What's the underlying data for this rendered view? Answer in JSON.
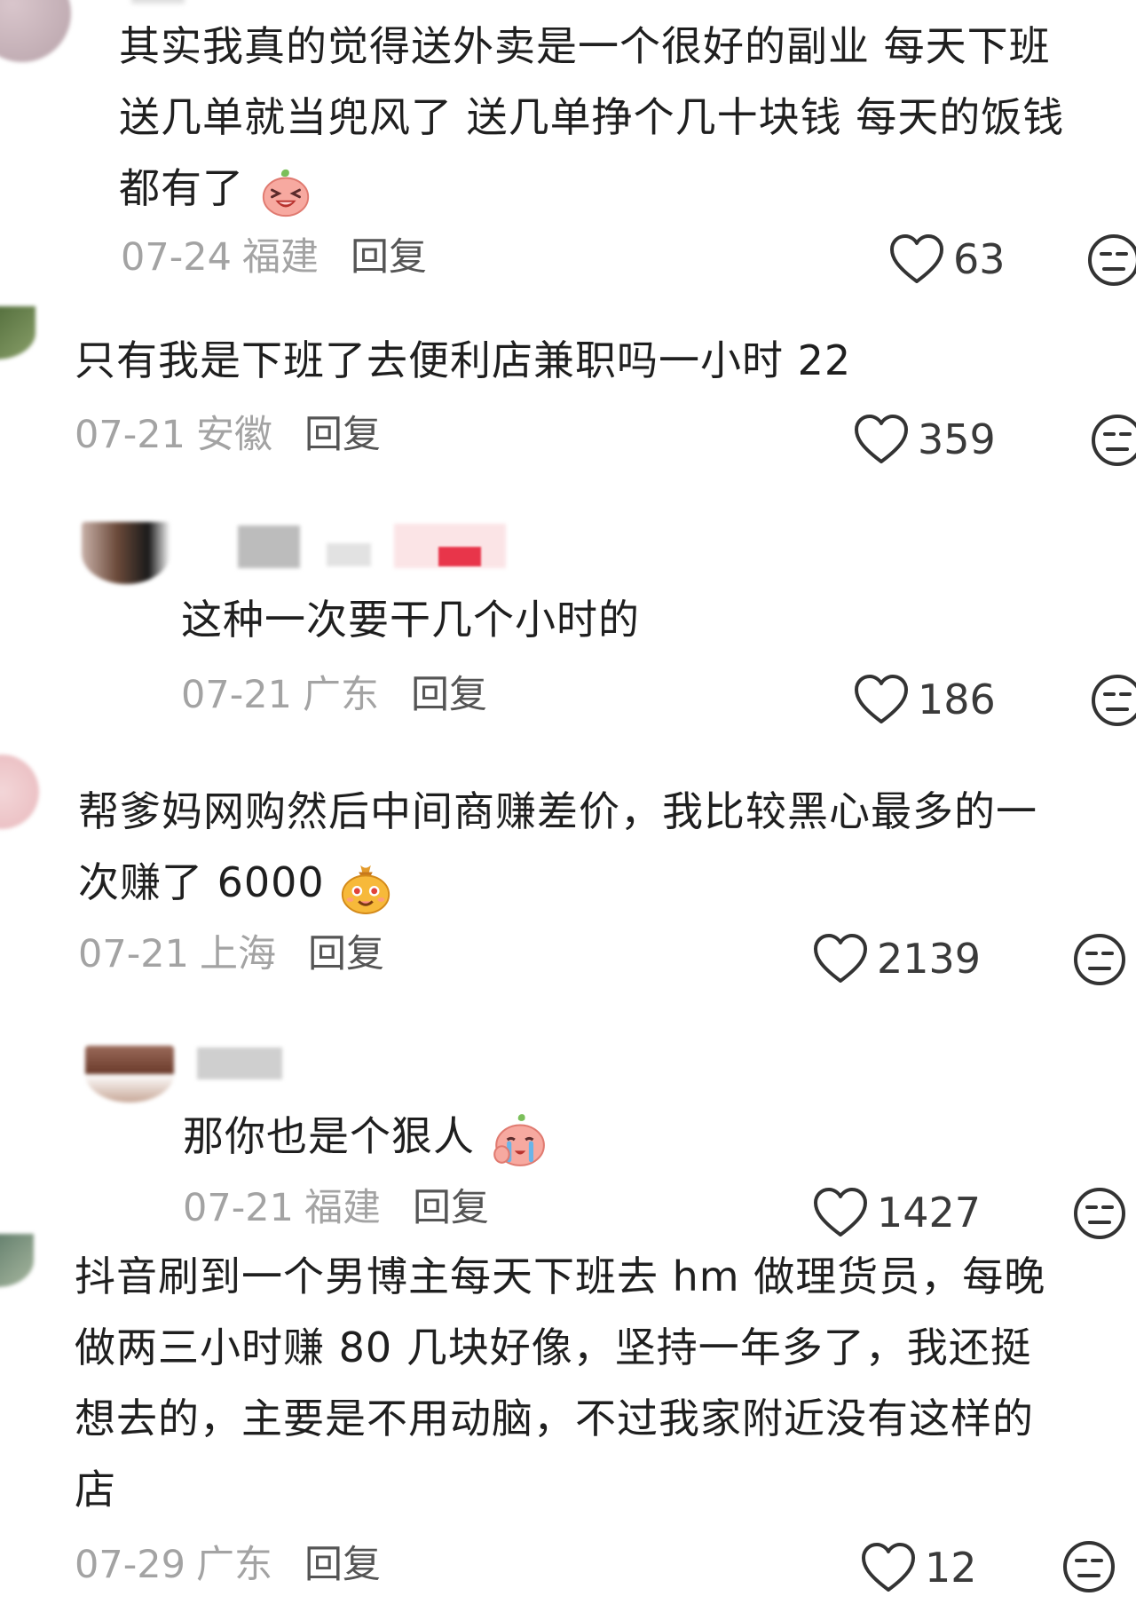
{
  "comments": [
    {
      "lines": [
        "其实我真的觉得送外卖是一个很好的副业 每天下班",
        "送几单就当兜风了 送几单挣个几十块钱 每天的饭钱",
        "都有了"
      ],
      "date": "07-24",
      "location": "福建",
      "reply": "回复",
      "likes": "63",
      "emoji": "laughing-bun-emoji"
    },
    {
      "lines": [
        "只有我是下班了去便利店兼职吗一小时 22"
      ],
      "date": "07-21",
      "location": "安徽",
      "reply": "回复",
      "likes": "359"
    },
    {
      "lines": [
        "这种一次要干几个小时的"
      ],
      "date": "07-21",
      "location": "广东",
      "reply": "回复",
      "likes": "186"
    },
    {
      "lines": [
        "帮爹妈网购然后中间商赚差价，我比较黑心最多的一",
        "次赚了 6000"
      ],
      "date": "07-21",
      "location": "上海",
      "reply": "回复",
      "likes": "2139",
      "emoji": "money-bag-emoji"
    },
    {
      "lines": [
        "那你也是个狠人"
      ],
      "date": "07-21",
      "location": "福建",
      "reply": "回复",
      "likes": "1427",
      "emoji": "crying-bun-emoji"
    },
    {
      "lines": [
        "抖音刷到一个男博主每天下班去 hm 做理货员，每晚",
        "做两三小时赚 80 几块好像，坚持一年多了，我还挺",
        "想去的，主要是不用动脑，不过我家附近没有这样的",
        "店"
      ],
      "date": "07-29",
      "location": "广东",
      "reply": "回复",
      "likes": "12"
    }
  ],
  "colors": {
    "text": "#1f1f1f",
    "meta": "#a3a3a3",
    "reply": "#555555"
  }
}
